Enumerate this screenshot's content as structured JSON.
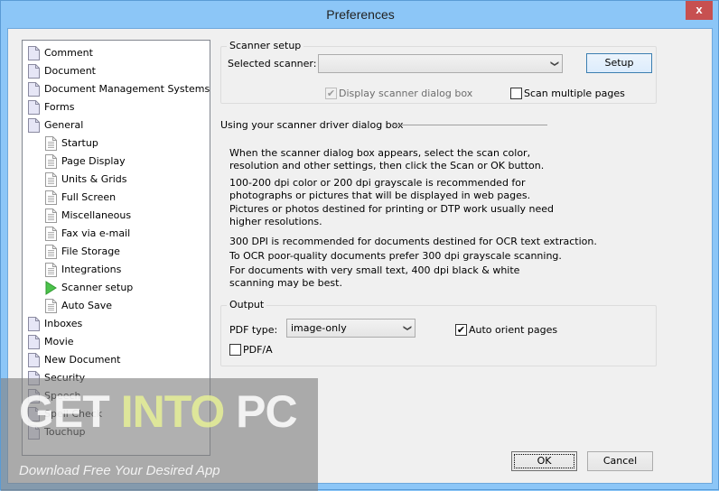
{
  "window": {
    "title": "Preferences",
    "close_label": "x"
  },
  "tree": {
    "items": [
      {
        "label": "Comment",
        "level": 0,
        "icon": "page-icon"
      },
      {
        "label": "Document",
        "level": 0,
        "icon": "page-icon"
      },
      {
        "label": "Document Management Systems",
        "level": 0,
        "icon": "page-icon"
      },
      {
        "label": "Forms",
        "level": 0,
        "icon": "page-icon"
      },
      {
        "label": "General",
        "level": 0,
        "icon": "page-icon"
      },
      {
        "label": "Startup",
        "level": 1,
        "icon": "text-page-icon"
      },
      {
        "label": "Page Display",
        "level": 1,
        "icon": "text-page-icon"
      },
      {
        "label": "Units & Grids",
        "level": 1,
        "icon": "text-page-icon"
      },
      {
        "label": "Full Screen",
        "level": 1,
        "icon": "text-page-icon"
      },
      {
        "label": "Miscellaneous",
        "level": 1,
        "icon": "text-page-icon"
      },
      {
        "label": "Fax via e-mail",
        "level": 1,
        "icon": "text-page-icon"
      },
      {
        "label": "File Storage",
        "level": 1,
        "icon": "text-page-icon"
      },
      {
        "label": "Integrations",
        "level": 1,
        "icon": "text-page-icon"
      },
      {
        "label": "Scanner setup",
        "level": 1,
        "icon": "play-arrow-icon",
        "selected": true
      },
      {
        "label": "Auto Save",
        "level": 1,
        "icon": "text-page-icon"
      },
      {
        "label": "Inboxes",
        "level": 0,
        "icon": "page-icon"
      },
      {
        "label": "Movie",
        "level": 0,
        "icon": "page-icon"
      },
      {
        "label": "New Document",
        "level": 0,
        "icon": "page-icon"
      },
      {
        "label": "Security",
        "level": 0,
        "icon": "page-icon"
      },
      {
        "label": "Speech",
        "level": 0,
        "icon": "page-icon"
      },
      {
        "label": "Spell Check",
        "level": 0,
        "icon": "page-icon"
      },
      {
        "label": "Touchup",
        "level": 0,
        "icon": "page-icon"
      }
    ]
  },
  "scanner_setup": {
    "legend": "Scanner setup",
    "selected_scanner_label": "Selected scanner:",
    "selected_scanner_value": "",
    "setup_button": "Setup",
    "display_dialog_label": "Display scanner dialog box",
    "display_dialog_checked": true,
    "display_dialog_disabled": true,
    "scan_multiple_label": "Scan multiple pages",
    "scan_multiple_checked": false
  },
  "driver_dialog": {
    "heading": "Using your scanner driver dialog box",
    "paragraphs": [
      "When the scanner dialog box appears, select the scan color, resolution and other settings, then click the Scan or OK button.",
      "100-200 dpi color or 200 dpi grayscale is recommended for photographs or pictures that will be displayed in web pages.",
      "Pictures or photos destined for printing or DTP work usually need higher resolutions.",
      "300 DPI is recommended for documents destined for OCR text extraction.",
      "To OCR poor-quality documents prefer 300 dpi grayscale scanning.",
      "For documents with very small text, 400 dpi black & white scanning may be best."
    ]
  },
  "output": {
    "legend": "Output",
    "pdf_type_label": "PDF type:",
    "pdf_type_value": "image-only",
    "auto_orient_label": "Auto orient pages",
    "auto_orient_checked": true,
    "pdfa_label": "PDF/A",
    "pdfa_checked": false
  },
  "buttons": {
    "ok": "OK",
    "cancel": "Cancel"
  },
  "watermark": {
    "get": "GET",
    "into": "INTO",
    "pc": "PC",
    "tagline": "Download Free Your Desired App"
  },
  "glyphs": {
    "check": "✔",
    "dropdown": "❯"
  }
}
